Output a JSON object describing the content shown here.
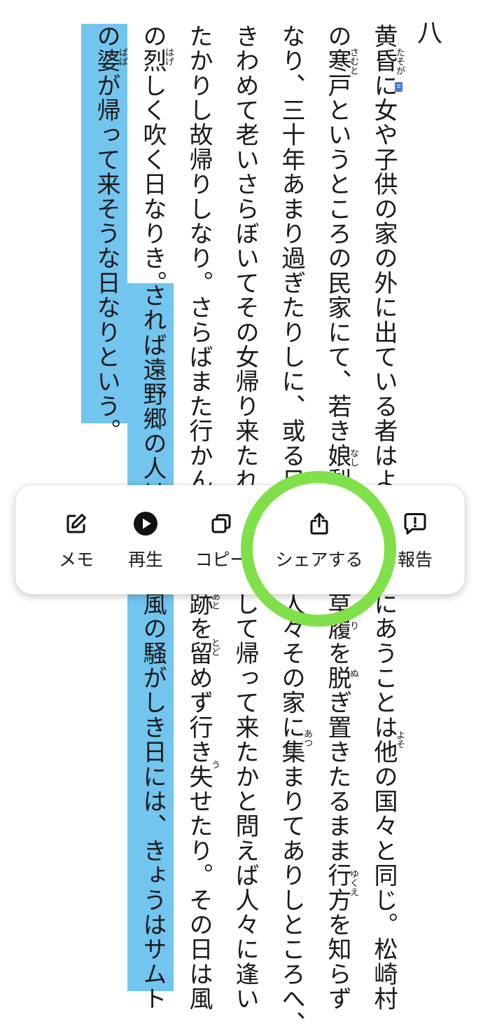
{
  "chapter_number": "八",
  "text_columns": [
    "黄昏に女や子供の家の外に出ている者はよ",
    "の寒戸というところの民家にて、若き娘梨",
    "なり、三十年あまり過ぎたりしに、或る日",
    "きわめて老いさらぼいてその女帰り来たれり",
    "たかりし故帰りしなり。さらばまた行かんと",
    "の烈しく吹く日なりき。",
    "の婆が帰って来そうな日なりという。"
  ],
  "lower_text_columns": [
    "にあうことは他の国々と同じ。松崎村",
    "草履を脱ぎ置きたるまま行方を知らず",
    "人々その家に集まりてありしところへ、",
    "して帰って来たかと問えば人々に逢い",
    "跡を留めず行き失せたり。その日は風",
    "風の騒がしき日には、きょうはサムト"
  ],
  "highlight_upper_column": "されば遠野郷の人は",
  "ruby": {
    "tasogare": "たそが",
    "samuto": "さむと",
    "nashi": "なし",
    "hage": "はげ",
    "baba": "ばば",
    "yoso": "よそ",
    "yukue": "ゆくえ",
    "nu": "ぬ",
    "ri": "り",
    "atsu": "あつ",
    "ato": "あと",
    "todo": "とど",
    "u": "う"
  },
  "context_menu": {
    "items": [
      {
        "label": "メモ",
        "icon": "memo-edit-icon"
      },
      {
        "label": "再生",
        "icon": "play-icon"
      },
      {
        "label": "コピー",
        "icon": "copy-icon"
      },
      {
        "label": "シェアする",
        "icon": "share-icon"
      },
      {
        "label": "報告",
        "icon": "report-icon"
      }
    ]
  },
  "colors": {
    "highlight": "#72c5ef",
    "focus_ring": "#80e04a",
    "memo_marker": "#4d7ad8"
  }
}
